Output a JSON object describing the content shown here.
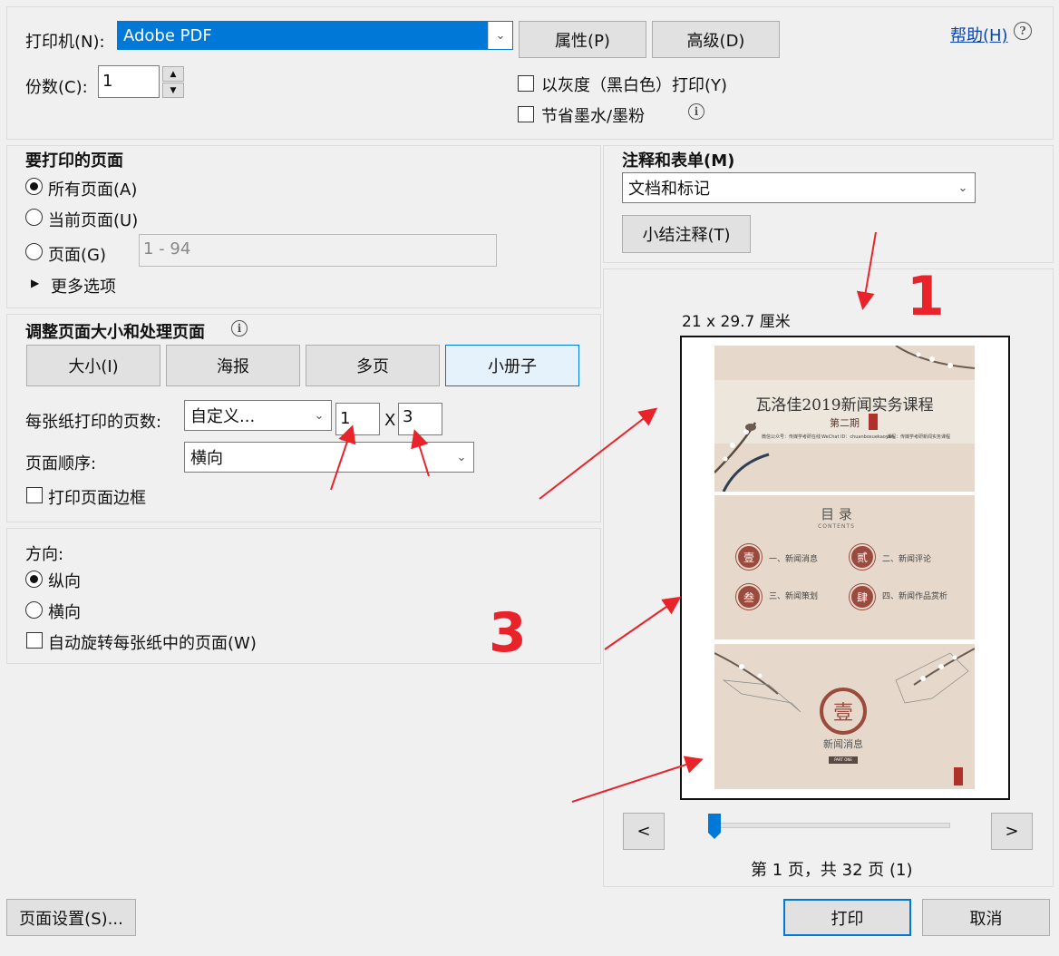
{
  "printer": {
    "label": "打印机(N):",
    "value": "Adobe PDF",
    "properties_btn": "属性(P)",
    "advanced_btn": "高级(D)",
    "help_link": "帮助(H)"
  },
  "copies": {
    "label": "份数(C):",
    "value": "1"
  },
  "options": {
    "grayscale": "以灰度（黑白色）打印(Y)",
    "save_ink": "节省墨水/墨粉"
  },
  "pages": {
    "title": "要打印的页面",
    "all": "所有页面(A)",
    "current": "当前页面(U)",
    "range": "页面(G)",
    "range_placeholder": "1 - 94",
    "more": "更多选项"
  },
  "sizing": {
    "title": "调整页面大小和处理页面",
    "tabs": [
      "大小(I)",
      "海报",
      "多页",
      "小册子"
    ],
    "pages_per_sheet_label": "每张纸打印的页数:",
    "pages_per_sheet_value": "自定义...",
    "cols": "1",
    "x": "X",
    "rows": "3",
    "order_label": "页面顺序:",
    "order_value": "横向",
    "border": "打印页面边框"
  },
  "orientation": {
    "title": "方向:",
    "portrait": "纵向",
    "landscape": "横向",
    "auto_rotate": "自动旋转每张纸中的页面(W)"
  },
  "comments": {
    "title": "注释和表单(M)",
    "value": "文档和标记",
    "summarize_btn": "小结注释(T)"
  },
  "preview": {
    "size": "21 x 29.7 厘米",
    "prev": "<",
    "next": ">",
    "page_info": "第 1 页，共 32 页 (1)",
    "slider_position": 0,
    "slide1": {
      "title": "瓦洛佳2019新闻实务课程",
      "subtitle": "第二期",
      "line1": "微信公众号：传媒学考研在线",
      "line2": "WeChat ID：chuanboxuekaoyan",
      "line3": "课程：传媒学考研新闻实务课程"
    },
    "slide2": {
      "title": "目 录",
      "sub": "CONTENTS",
      "items": [
        {
          "num": "壹",
          "text": "一、新闻消息"
        },
        {
          "num": "贰",
          "text": "二、新闻评论"
        },
        {
          "num": "叁",
          "text": "三、新闻策划"
        },
        {
          "num": "肆",
          "text": "四、新闻作品赏析"
        }
      ]
    },
    "slide3": {
      "big": "壹",
      "title": "新闻消息",
      "tag": "PART ONE"
    }
  },
  "annotations": {
    "one": "1",
    "three": "3"
  },
  "footer": {
    "page_setup": "页面设置(S)...",
    "print": "打印",
    "cancel": "取消"
  },
  "colors": {
    "accent": "#0078d7",
    "annotation": "#e8232a",
    "slide_bg": "#e6d9cb",
    "seal": "#9b4a3e"
  }
}
